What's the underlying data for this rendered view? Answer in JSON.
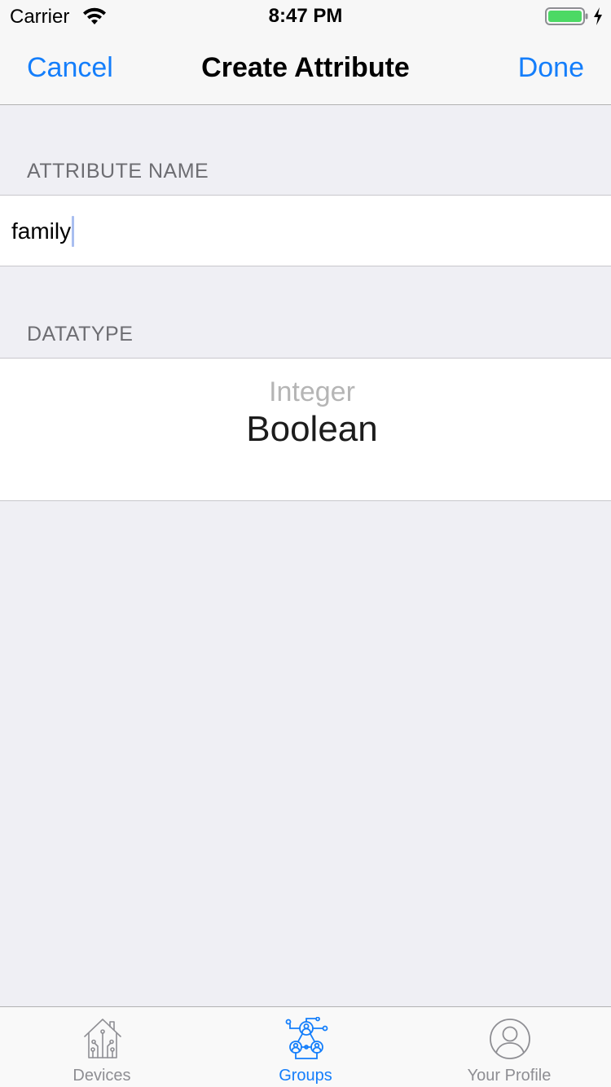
{
  "status_bar": {
    "carrier": "Carrier",
    "time": "8:47 PM"
  },
  "nav": {
    "cancel_label": "Cancel",
    "title": "Create Attribute",
    "done_label": "Done"
  },
  "attribute_name": {
    "header": "ATTRIBUTE NAME",
    "value": "family"
  },
  "datatype": {
    "header": "DATATYPE",
    "options_visible": [
      "Integer",
      "Boolean"
    ],
    "selected": "Boolean",
    "previous": "Integer"
  },
  "tab_bar": {
    "tabs": [
      {
        "label": "Devices",
        "icon": "home-circuit-icon",
        "active": false
      },
      {
        "label": "Groups",
        "icon": "groups-network-icon",
        "active": true
      },
      {
        "label": "Your Profile",
        "icon": "profile-icon",
        "active": false
      }
    ]
  },
  "colors": {
    "accent": "#147efb",
    "background": "#efeff4",
    "section_header": "#6d6d72",
    "tab_inactive": "#8e8e93",
    "battery": "#4cd964"
  }
}
